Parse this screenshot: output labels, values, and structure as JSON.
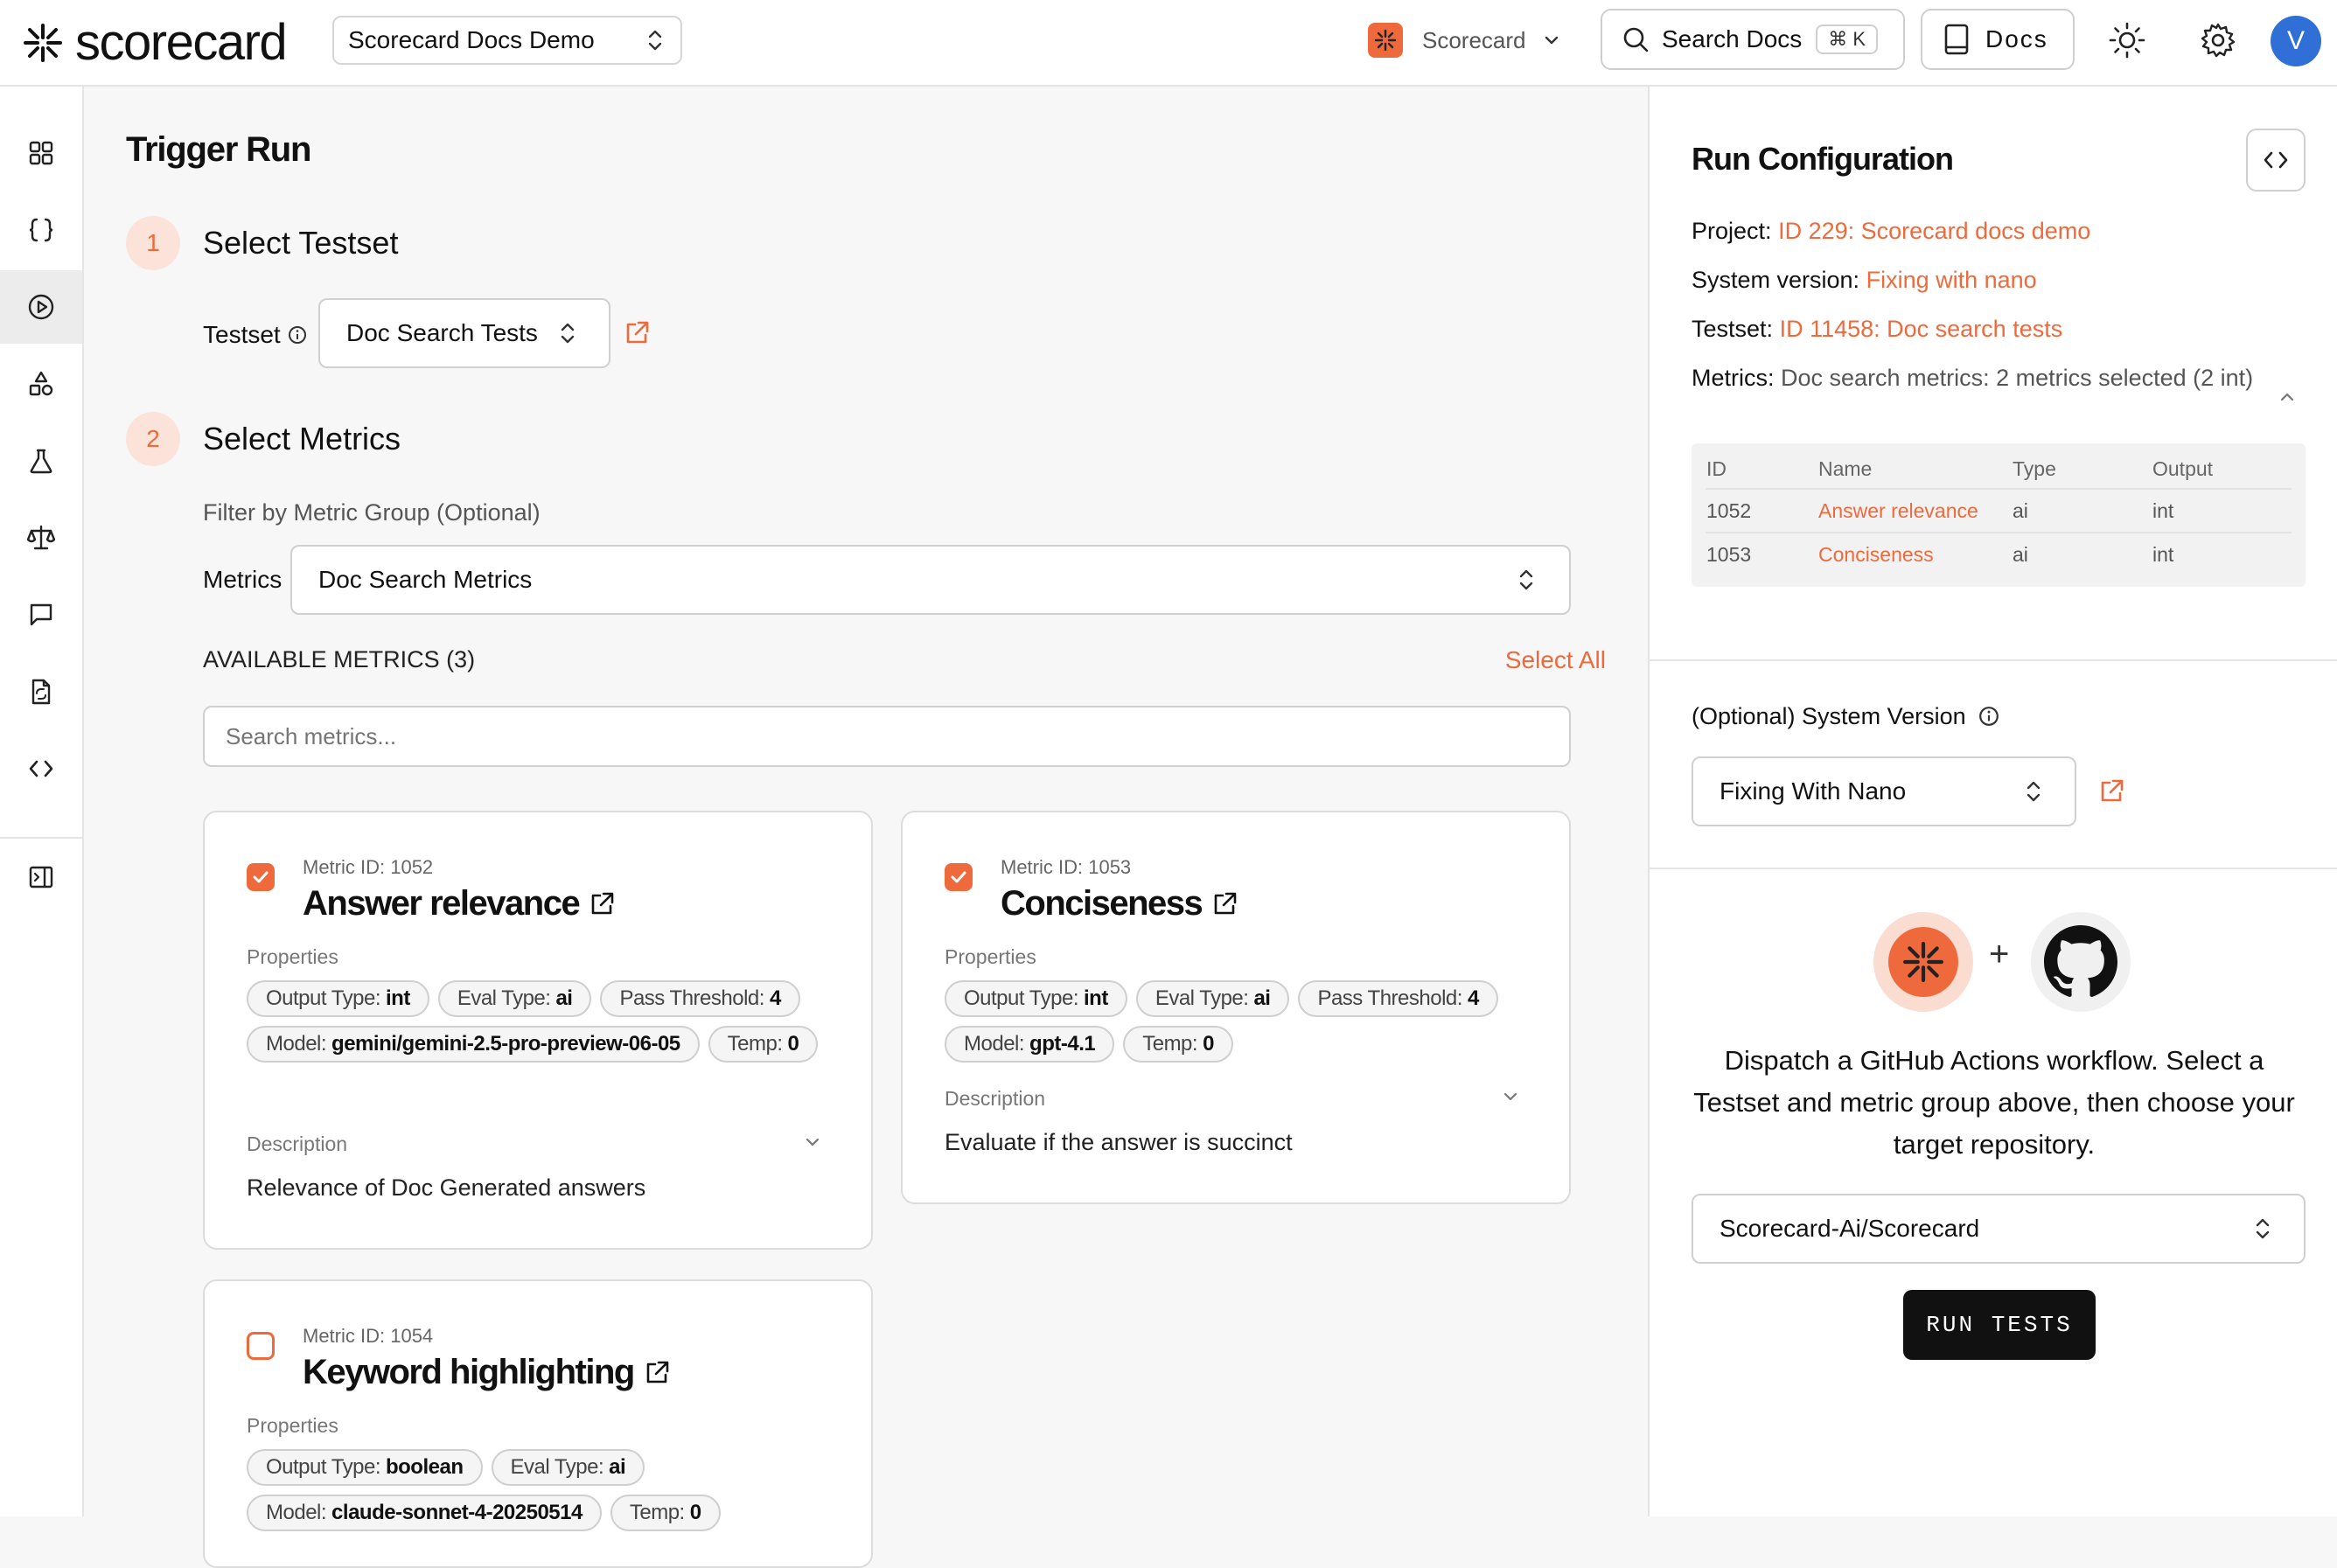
{
  "brand": {
    "name": "scorecard",
    "accent": "#ee6a3c"
  },
  "header": {
    "project_selector": "Scorecard Docs Demo",
    "org_name": "Scorecard",
    "search_label": "Search Docs",
    "search_shortcut": "⌘ K",
    "docs_label": "Docs",
    "avatar_initial": "V"
  },
  "sidebar": {
    "items": [
      {
        "icon": "grid-icon"
      },
      {
        "icon": "braces-icon"
      },
      {
        "icon": "play-circle-icon",
        "active": true
      },
      {
        "icon": "shapes-icon"
      },
      {
        "icon": "flask-icon"
      },
      {
        "icon": "scale-icon"
      },
      {
        "icon": "chat-icon"
      },
      {
        "icon": "file-sync-icon"
      },
      {
        "icon": "code-icon"
      }
    ],
    "bottom_icon": "panel-toggle-icon"
  },
  "main": {
    "title": "Trigger Run",
    "step1": {
      "number": "1",
      "title": "Select Testset",
      "testset_label": "Testset",
      "testset_value": "Doc Search Tests"
    },
    "step2": {
      "number": "2",
      "title": "Select Metrics",
      "filter_label": "Filter by Metric Group (Optional)",
      "metrics_label": "Metrics",
      "metrics_value": "Doc Search Metrics",
      "available_label": "AVAILABLE METRICS (3)",
      "select_all": "Select All",
      "search_placeholder": "Search metrics...",
      "properties_label": "Properties",
      "description_label": "Description"
    },
    "metrics": [
      {
        "id_label": "Metric ID: 1052",
        "name": "Answer relevance",
        "checked": true,
        "tags": [
          {
            "k": "Output Type:",
            "v": "int"
          },
          {
            "k": "Eval Type:",
            "v": "ai"
          },
          {
            "k": "Pass Threshold:",
            "v": "4"
          },
          {
            "k": "Model:",
            "v": "gemini/gemini-2.5-pro-preview-06-05"
          },
          {
            "k": "Temp:",
            "v": "0"
          }
        ],
        "description": "Relevance of Doc Generated answers"
      },
      {
        "id_label": "Metric ID: 1053",
        "name": "Conciseness",
        "checked": true,
        "tags": [
          {
            "k": "Output Type:",
            "v": "int"
          },
          {
            "k": "Eval Type:",
            "v": "ai"
          },
          {
            "k": "Pass Threshold:",
            "v": "4"
          },
          {
            "k": "Model:",
            "v": "gpt-4.1"
          },
          {
            "k": "Temp:",
            "v": "0"
          }
        ],
        "description": "Evaluate if the answer is succinct"
      },
      {
        "id_label": "Metric ID: 1054",
        "name": "Keyword highlighting",
        "checked": false,
        "tags": [
          {
            "k": "Output Type:",
            "v": "boolean"
          },
          {
            "k": "Eval Type:",
            "v": "ai"
          },
          {
            "k": "Model:",
            "v": "claude-sonnet-4-20250514"
          },
          {
            "k": "Temp:",
            "v": "0"
          }
        ]
      }
    ]
  },
  "run_config": {
    "title": "Run Configuration",
    "project_label": "Project:",
    "project_value": "ID 229: Scorecard docs demo",
    "system_label": "System version:",
    "system_value": "Fixing with nano",
    "testset_label": "Testset:",
    "testset_value": "ID 11458: Doc search tests",
    "metrics_label": "Metrics:",
    "metrics_value": "Doc search metrics: 2 metrics selected (2 int)",
    "table": {
      "headers": [
        "ID",
        "Name",
        "Type",
        "Output"
      ],
      "rows": [
        [
          "1052",
          "Answer relevance",
          "ai",
          "int"
        ],
        [
          "1053",
          "Conciseness",
          "ai",
          "int"
        ]
      ]
    },
    "optional_version_label": "(Optional) System Version",
    "optional_version_value": "Fixing With Nano",
    "dispatch_text": "Dispatch a GitHub Actions workflow. Select a Testset and metric group above, then choose your target repository.",
    "repo_value": "Scorecard-Ai/Scorecard",
    "run_button": "RUN TESTS",
    "plus": "+"
  }
}
